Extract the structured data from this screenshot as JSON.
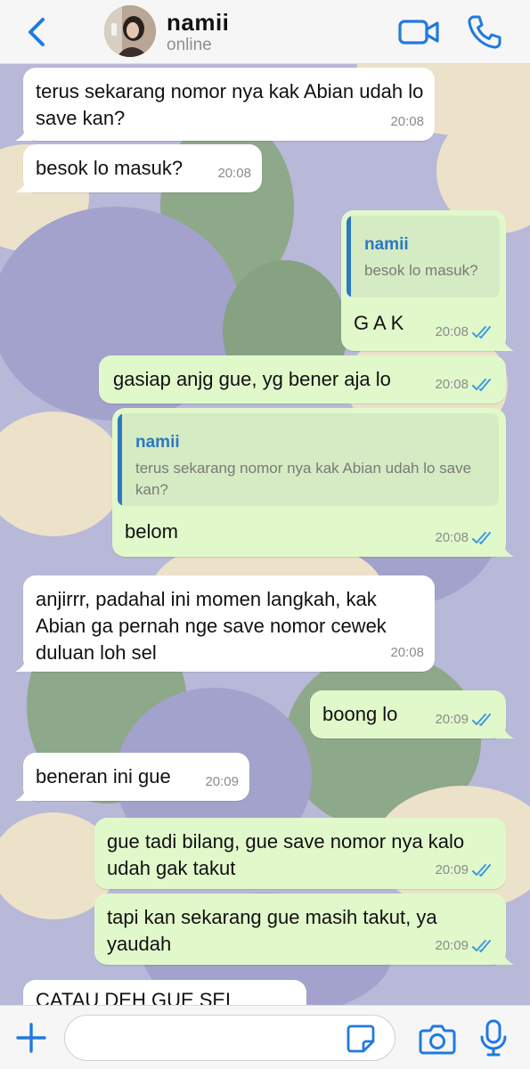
{
  "header": {
    "name": "namii",
    "status": "online",
    "icons": {
      "back": "chevron-left-icon",
      "video": "video-camera-icon",
      "call": "phone-icon"
    }
  },
  "messages": [
    {
      "id": 1,
      "direction": "incoming",
      "text": "terus sekarang nomor nya kak Abian udah lo save kan?",
      "time": "20:08"
    },
    {
      "id": 2,
      "direction": "incoming",
      "text": "besok lo masuk?",
      "time": "20:08"
    },
    {
      "id": 3,
      "direction": "outgoing",
      "quote": {
        "author": "namii",
        "text": "besok lo masuk?"
      },
      "text": "G A K",
      "time": "20:08",
      "status": "read"
    },
    {
      "id": 4,
      "direction": "outgoing",
      "text": "gasiap anjg gue, yg bener aja lo",
      "time": "20:08",
      "status": "read"
    },
    {
      "id": 5,
      "direction": "outgoing",
      "quote": {
        "author": "namii",
        "text": "terus sekarang nomor nya kak Abian udah lo save kan?"
      },
      "text": "belom",
      "time": "20:08",
      "status": "read"
    },
    {
      "id": 6,
      "direction": "incoming",
      "text": "anjirrr, padahal ini momen langkah, kak Abian ga pernah nge save nomor cewek duluan loh sel",
      "time": "20:08"
    },
    {
      "id": 7,
      "direction": "outgoing",
      "text": "boong lo",
      "time": "20:09",
      "status": "read"
    },
    {
      "id": 8,
      "direction": "incoming",
      "text": "beneran ini gue",
      "time": "20:09"
    },
    {
      "id": 9,
      "direction": "outgoing",
      "text": "gue tadi bilang, gue save nomor nya kalo udah gak takut",
      "time": "20:09",
      "status": "read"
    },
    {
      "id": 10,
      "direction": "outgoing",
      "text": "tapi kan sekarang gue masih takut, ya yaudah",
      "time": "20:09",
      "status": "read"
    },
    {
      "id": 11,
      "direction": "incoming",
      "text": "CATAU DEH GUE SEL",
      "time": ""
    }
  ],
  "composer": {
    "value": "",
    "placeholder": "",
    "icons": {
      "attach": "plus-icon",
      "sticker": "sticker-icon",
      "camera": "camera-icon",
      "mic": "microphone-icon"
    }
  },
  "colors": {
    "accent": "#1f7ae0",
    "incoming_bubble": "#ffffff",
    "outgoing_bubble": "#e1f8cb",
    "quote_author": "#2b78c4",
    "read_ticks": "#3c9be0",
    "wallpaper_base": "#b8b8d8"
  }
}
